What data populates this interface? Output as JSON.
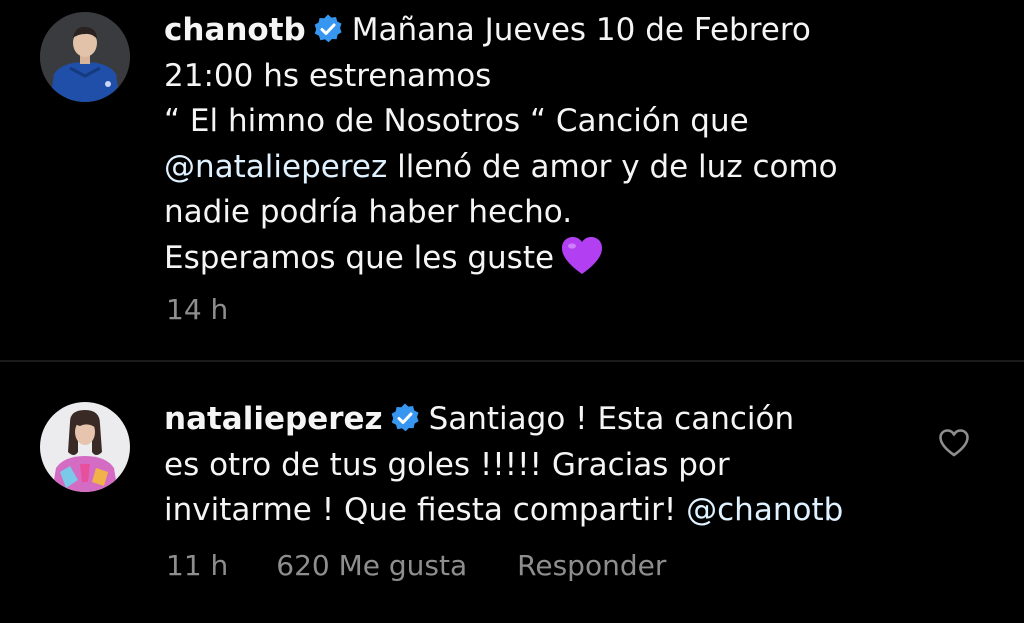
{
  "caption": {
    "username": "chanotb",
    "lines": [
      "Mañana Jueves 10 de Febrero",
      "21:00 hs estrenamos",
      "“ El himno de Nosotros “ Canción que",
      "llenó de amor y de luz como",
      "nadie podría haber hecho.",
      "Esperamos que les guste"
    ],
    "mention": "@natalieperez",
    "emoji": "purple-heart",
    "time": "14 h"
  },
  "reply": {
    "username": "natalieperez",
    "lines": [
      "Santiago ! Esta canción",
      "es otro de tus goles !!!!! Gracias por",
      "invitarme ! Que fiesta compartir!"
    ],
    "mention": "@chanotb",
    "time": "11 h",
    "likes": "620 Me gusta",
    "respond": "Responder"
  },
  "colors": {
    "background": "#000000",
    "verified": "#3797f0",
    "meta_text": "#8e8e8e",
    "heart_emoji": "#b23ff2"
  },
  "icons": {
    "verified": "verified-badge-icon",
    "like": "heart-outline-icon"
  }
}
